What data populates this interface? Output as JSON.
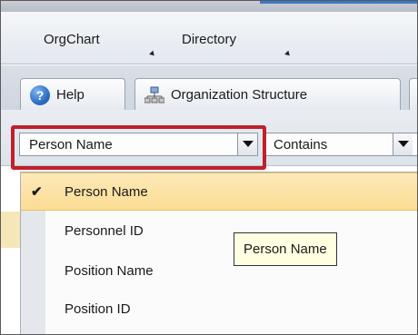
{
  "menubar": {
    "items": [
      {
        "label": "OrgChart"
      },
      {
        "label": "Directory"
      }
    ]
  },
  "tabs": [
    {
      "label": "Help",
      "icon": "help-icon"
    },
    {
      "label": "Organization Structure",
      "icon": "org-structure-icon"
    }
  ],
  "filter": {
    "field_value": "Person Name",
    "operator_value": "Contains"
  },
  "dropdown": {
    "selected_index": 0,
    "options": [
      {
        "label": "Person Name"
      },
      {
        "label": "Personnel ID"
      },
      {
        "label": "Position Name"
      },
      {
        "label": "Position ID"
      }
    ]
  },
  "tooltip": {
    "text": "Person Name"
  },
  "colors": {
    "highlight_border": "#c0202a",
    "selected_option": "#fbdc94",
    "tooltip_bg": "#ffffe1"
  }
}
